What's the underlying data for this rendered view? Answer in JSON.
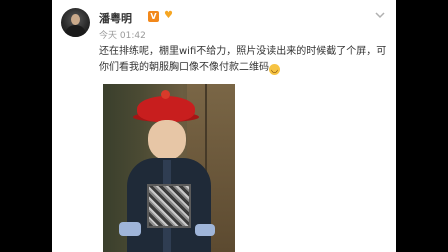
{
  "post": {
    "username": "潘粤明",
    "vip_badge": "V",
    "level_badge": "♥",
    "time": "今天 01:42",
    "text": "还在排练呢，棚里wifi不给力，照片没读出来的时候截了个屏，可你们看我的朝服胸口像不像付款二维码",
    "emoji": "😂"
  },
  "colors": {
    "accent": "#f2881b",
    "username": "#333333",
    "meta": "#9a9a9a"
  },
  "icons": {
    "more": "chevron-down-icon",
    "vip": "verified-badge-icon"
  }
}
